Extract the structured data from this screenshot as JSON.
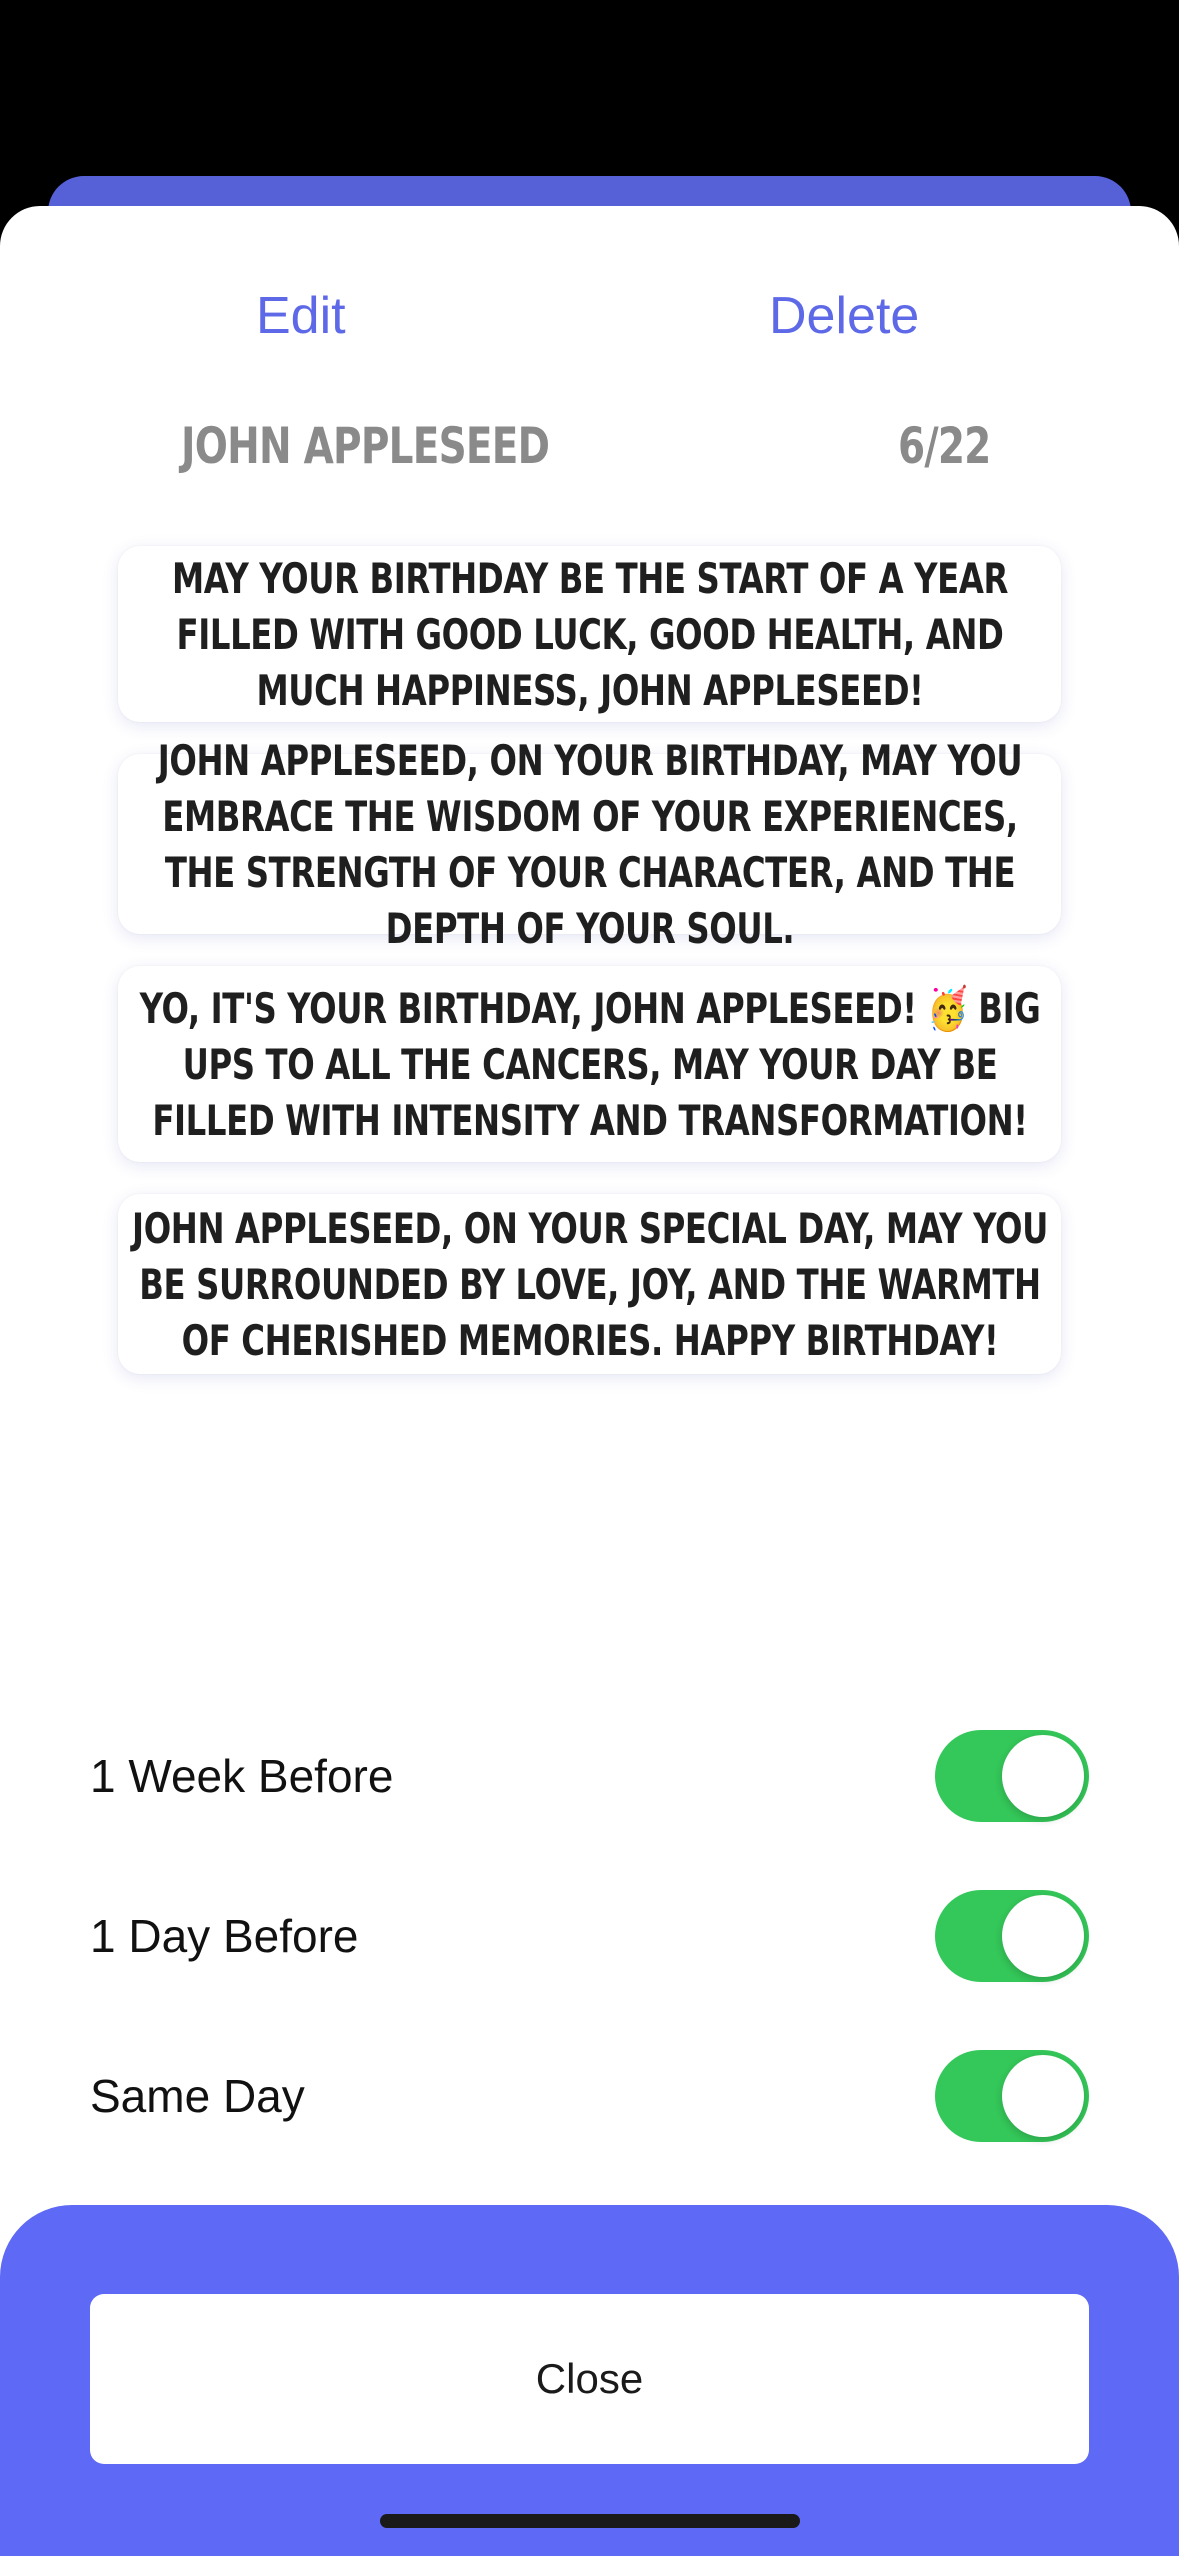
{
  "actions": {
    "edit_label": "Edit",
    "delete_label": "Delete"
  },
  "contact": {
    "name": "JOHN APPLESEED",
    "date": "6/22"
  },
  "wishes": [
    "MAY YOUR BIRTHDAY BE THE START OF A YEAR FILLED WITH GOOD LUCK, GOOD HEALTH, AND MUCH HAPPINESS, JOHN APPLESEED!",
    "JOHN APPLESEED, ON YOUR BIRTHDAY, MAY YOU EMBRACE THE WISDOM OF YOUR EXPERIENCES, THE STRENGTH OF YOUR CHARACTER, AND THE DEPTH OF YOUR SOUL.",
    "YO, IT'S YOUR BIRTHDAY, JOHN APPLESEED! 🥳 BIG UPS TO ALL THE CANCERS, MAY YOUR DAY BE FILLED WITH INTENSITY AND TRANSFORMATION!",
    "JOHN APPLESEED, ON YOUR SPECIAL DAY, MAY YOU BE SURROUNDED BY LOVE, JOY, AND THE WARMTH OF CHERISHED MEMORIES. HAPPY BIRTHDAY!"
  ],
  "reminders": [
    {
      "label": "1 Week Before",
      "enabled": true
    },
    {
      "label": "1 Day Before",
      "enabled": true
    },
    {
      "label": "Same Day",
      "enabled": true
    }
  ],
  "footer": {
    "close_label": "Close"
  },
  "colors": {
    "accent": "#5e69e8",
    "footer_bg": "#5e69f5",
    "toggle_on": "#34c759"
  }
}
